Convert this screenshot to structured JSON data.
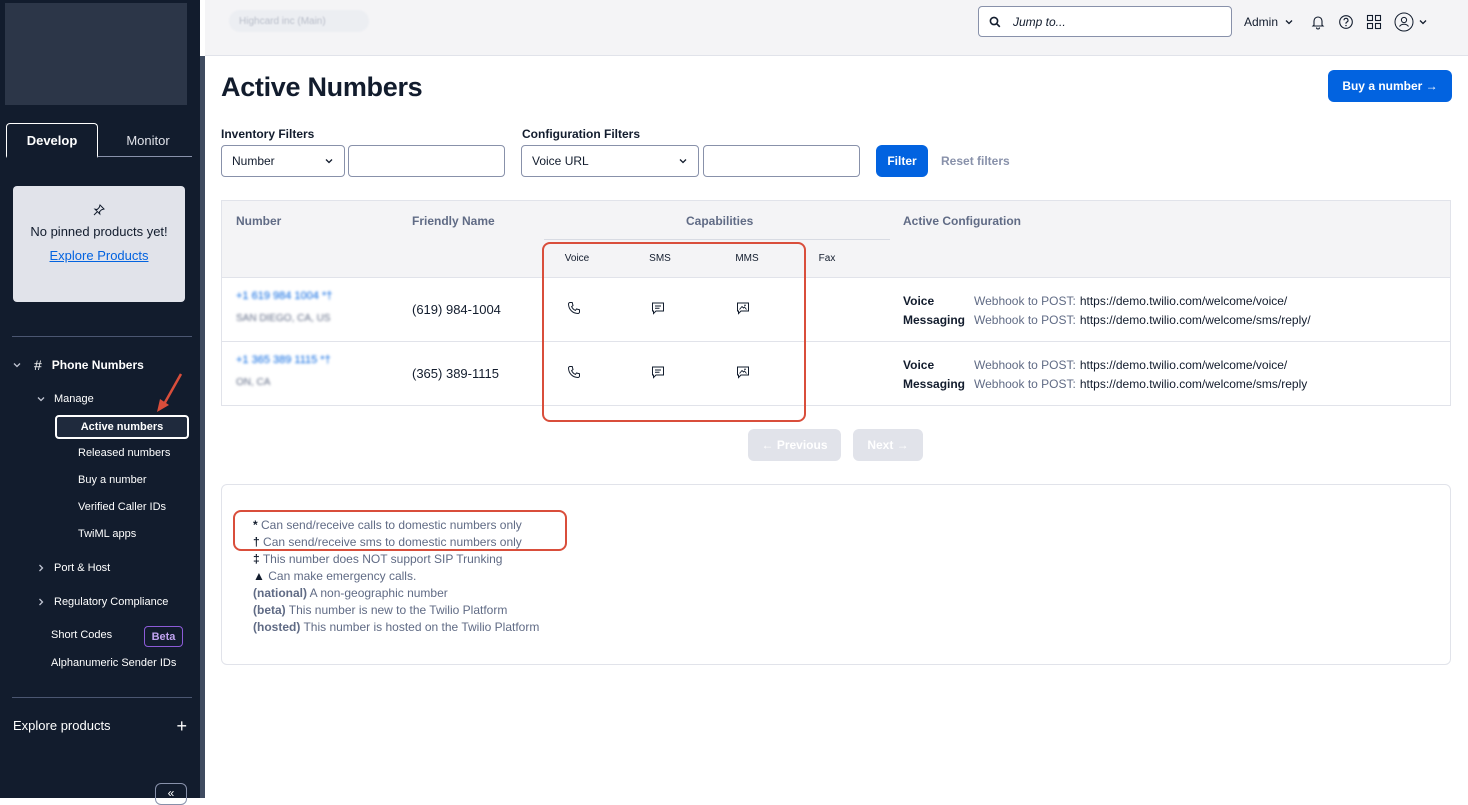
{
  "topbar": {
    "account_name": "Highcard inc (Main)",
    "search_placeholder": "Jump to...",
    "user_menu": "Admin"
  },
  "sidebar": {
    "tabs": [
      "Develop",
      "Monitor"
    ],
    "pinned_message": "No pinned products yet!",
    "explore_link": "Explore Products",
    "section": "Phone Numbers",
    "manage": "Manage",
    "items": [
      "Active numbers",
      "Released numbers",
      "Buy a number",
      "Verified Caller IDs",
      "TwiML apps"
    ],
    "port_host": "Port & Host",
    "regulatory": "Regulatory Compliance",
    "short_codes": "Short Codes",
    "beta": "Beta",
    "alphanumeric": "Alphanumeric Sender IDs",
    "explore_products": "Explore products",
    "collapse": "«"
  },
  "page": {
    "title": "Active Numbers",
    "buy_button": "Buy a number →"
  },
  "filters": {
    "inventory_label": "Inventory Filters",
    "inventory_value": "Number",
    "config_label": "Configuration Filters",
    "config_value": "Voice URL",
    "filter_button": "Filter",
    "reset_button": "Reset filters"
  },
  "table": {
    "headers": {
      "number": "Number",
      "friendly_name": "Friendly Name",
      "capabilities": "Capabilities",
      "active_config": "Active Configuration",
      "voice": "Voice",
      "sms": "SMS",
      "mms": "MMS",
      "fax": "Fax"
    },
    "rows": [
      {
        "number": "+1 619 984 1004 *†",
        "location": "SAN DIEGO, CA, US",
        "friendly_name": "(619) 984-1004",
        "voice_label": "Voice",
        "voice_pre": "Webhook to POST:",
        "voice_url": "https://demo.twilio.com/welcome/voice/",
        "messaging_label": "Messaging",
        "messaging_pre": "Webhook to POST:",
        "messaging_url": "https://demo.twilio.com/welcome/sms/reply/"
      },
      {
        "number": "+1 365 389 1115 *†",
        "location": "ON, CA",
        "friendly_name": "(365) 389-1115",
        "voice_label": "Voice",
        "voice_pre": "Webhook to POST:",
        "voice_url": "https://demo.twilio.com/welcome/voice/",
        "messaging_label": "Messaging",
        "messaging_pre": "Webhook to POST:",
        "messaging_url": "https://demo.twilio.com/welcome/sms/reply"
      }
    ]
  },
  "pagination": {
    "previous": "← Previous",
    "next": "Next →"
  },
  "legend": {
    "calls_mark": "*",
    "calls": "Can send/receive calls to domestic numbers only",
    "sms_mark": "†",
    "sms": "Can send/receive sms to domestic numbers only",
    "sip_mark": "‡",
    "sip": "This number does NOT support SIP Trunking",
    "emergency_mark": "▲",
    "emergency": "Can make emergency calls.",
    "national_tag": "(national)",
    "national": "A non-geographic number",
    "beta_tag": "(beta)",
    "beta": "This number is new to the Twilio Platform",
    "hosted_tag": "(hosted)",
    "hosted": "This number is hosted on the Twilio Platform"
  },
  "colors": {
    "brand_blue": "#0263e0",
    "sidebar_bg": "#121c2d",
    "annotation_red": "#d94e3b"
  }
}
